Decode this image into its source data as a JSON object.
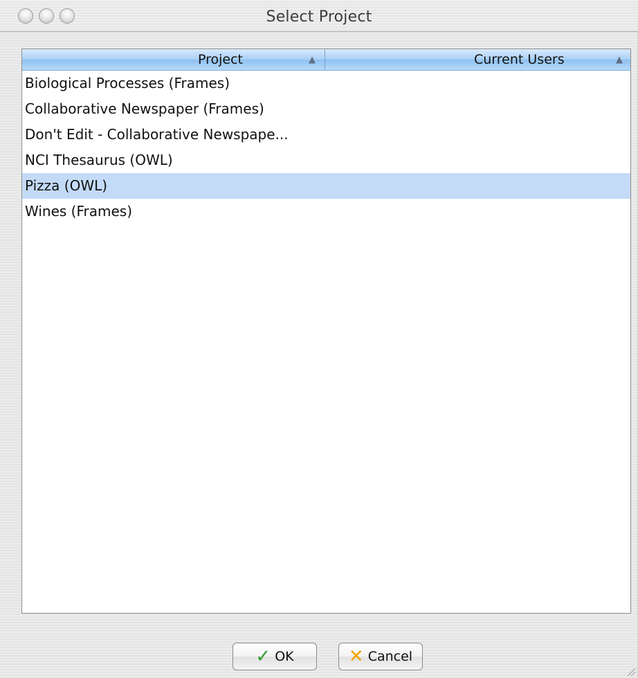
{
  "window": {
    "title": "Select Project"
  },
  "table": {
    "columns": [
      {
        "label": "Project",
        "sort": "ascending"
      },
      {
        "label": "Current Users",
        "sort": "ascending"
      }
    ],
    "rows": [
      {
        "project": "Biological Processes (Frames)",
        "users": ""
      },
      {
        "project": "Collaborative Newspaper (Frames)",
        "users": ""
      },
      {
        "project": "Don't Edit - Collaborative Newspape...",
        "users": ""
      },
      {
        "project": "NCI Thesaurus (OWL)",
        "users": ""
      },
      {
        "project": "Pizza (OWL)",
        "users": "",
        "selected": true
      },
      {
        "project": "Wines (Frames)",
        "users": ""
      }
    ]
  },
  "buttons": {
    "ok_label": "OK",
    "cancel_label": "Cancel"
  },
  "icons": {
    "ok": "check-icon",
    "cancel": "x-icon",
    "sort": "triangle-up-icon"
  },
  "colors": {
    "selection": "#c3dbf7",
    "header_accent": "#a9cff5"
  }
}
